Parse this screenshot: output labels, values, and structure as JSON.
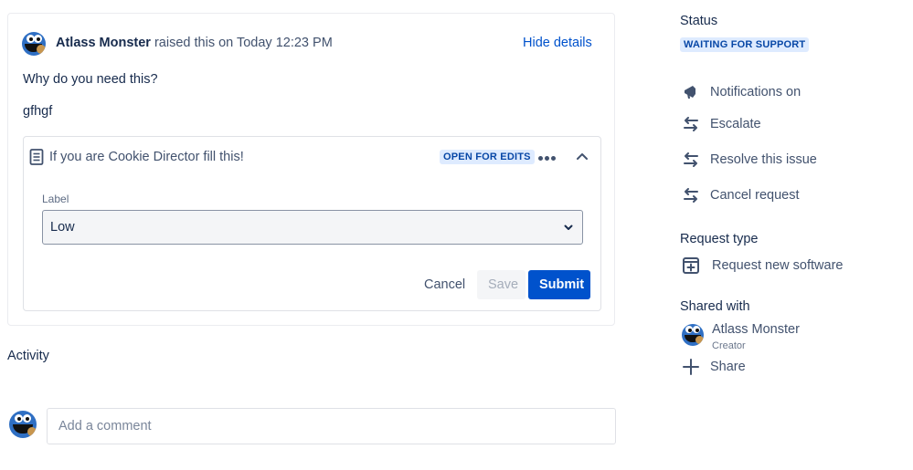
{
  "request": {
    "reporter_name": "Atlass Monster",
    "raised_text": " raised this on Today 12:23 PM",
    "hide_details_label": "Hide details",
    "question": "Why do you need this?",
    "answer": "gfhgf"
  },
  "form": {
    "title": "If you are Cookie Director fill this!",
    "status_lozenge": "OPEN FOR EDITS",
    "field_label": "Label",
    "field_value": "Low",
    "cancel_label": "Cancel",
    "save_label": "Save",
    "submit_label": "Submit"
  },
  "activity": {
    "heading": "Activity",
    "comment_placeholder": "Add a comment"
  },
  "sidebar": {
    "status_heading": "Status",
    "status_value": "WAITING FOR SUPPORT",
    "actions": [
      {
        "label": "Notifications on",
        "icon": "megaphone-icon"
      },
      {
        "label": "Escalate",
        "icon": "transition-arrows-icon"
      },
      {
        "label": "Resolve this issue",
        "icon": "transition-arrows-icon"
      },
      {
        "label": "Cancel request",
        "icon": "transition-arrows-icon"
      }
    ],
    "request_type_heading": "Request type",
    "request_type_value": "Request new software",
    "shared_with_heading": "Shared with",
    "shared_user_name": "Atlass Monster",
    "shared_user_role": "Creator",
    "share_label": "Share"
  },
  "colors": {
    "primary": "#0052cc",
    "lozenge_bg": "#deebff",
    "lozenge_text": "#0747a6",
    "text": "#172b4d",
    "subtle_text": "#42526e"
  }
}
